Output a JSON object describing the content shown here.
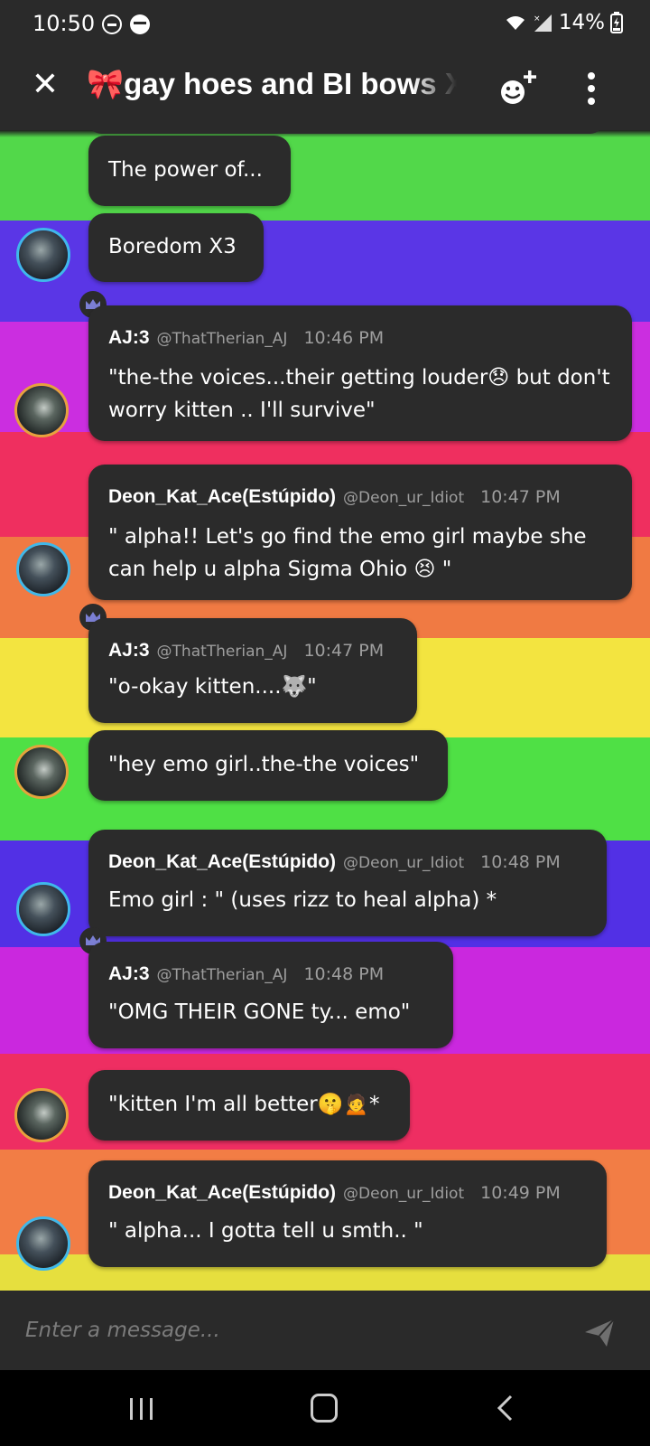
{
  "status_bar": {
    "time": "10:50",
    "battery": "14%"
  },
  "header": {
    "title": "🎀gay hoes and BI bows X",
    "icons": [
      "close-icon",
      "add-member-icon",
      "more-vert-icon"
    ]
  },
  "background_stripes": [
    "#52d84a",
    "#5a36e6",
    "#cb2ee0",
    "#ef2f5f",
    "#f07a43",
    "#f3e440",
    "#4fe045",
    "#5230e5",
    "#ca28de",
    "#ee2e62",
    "#f27d45",
    "#e6df3e"
  ],
  "messages": [
    {
      "text": "The power of..."
    },
    {
      "text": "Boredom X3"
    },
    {
      "username": "AJ:3",
      "handle": "@ThatTherian_AJ",
      "time": "10:46 PM",
      "text": "\"the-the voices...their getting louder😞 but don't worry kitten .. I'll survive\""
    },
    {
      "username": "Deon_Kat_Ace(Estúpido)",
      "handle": "@Deon_ur_Idiot",
      "time": "10:47 PM",
      "text": "\" alpha!! Let's go find the emo girl maybe she can help u alpha Sigma Ohio 😣 \""
    },
    {
      "username": "AJ:3",
      "handle": "@ThatTherian_AJ",
      "time": "10:47 PM",
      "text": "\"o-okay kitten....🐺\""
    },
    {
      "text": "\"hey emo girl..the-the voices\""
    },
    {
      "username": "Deon_Kat_Ace(Estúpido)",
      "handle": "@Deon_ur_Idiot",
      "time": "10:48 PM",
      "text": "Emo girl : \" (uses rizz to heal alpha) *"
    },
    {
      "username": "AJ:3",
      "handle": "@ThatTherian_AJ",
      "time": "10:48 PM",
      "text": "\"OMG THEIR GONE ty... emo\""
    },
    {
      "text": "\"kitten I'm all better🤫🙍*"
    },
    {
      "username": "Deon_Kat_Ace(Estúpido)",
      "handle": "@Deon_ur_Idiot",
      "time": "10:49 PM",
      "text": "\" alpha... I gotta tell u smth.. \""
    }
  ],
  "input": {
    "placeholder": "Enter a message..."
  },
  "colors": {
    "bubble": "#2b2b2b",
    "bar": "#2a2a2a",
    "crown": "#7b7fd4",
    "avatar_ring_blue": "#3fb8ea",
    "avatar_ring_gold": "#e6a23c"
  }
}
